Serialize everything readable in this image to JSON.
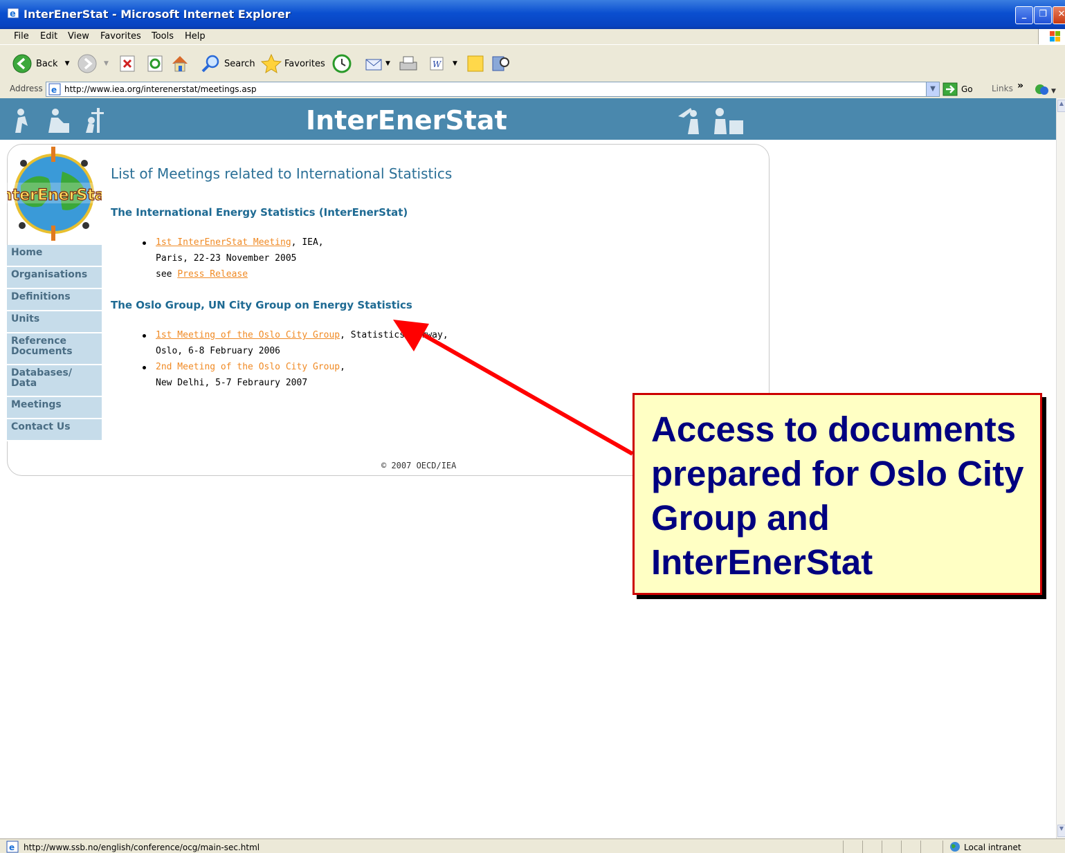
{
  "window": {
    "title": "InterEnerStat - Microsoft Internet Explorer",
    "controls": [
      "minimize",
      "restore",
      "close"
    ]
  },
  "menu": [
    "File",
    "Edit",
    "View",
    "Favorites",
    "Tools",
    "Help"
  ],
  "toolbar": {
    "back_label": "Back",
    "search_label": "Search",
    "favorites_label": "Favorites"
  },
  "address": {
    "label": "Address",
    "url": "http://www.iea.org/interenerstat/meetings.asp",
    "go_label": "Go",
    "links_label": "Links"
  },
  "site": {
    "brand": "InterEnerStat",
    "logo_text": "InterEnerStat",
    "nav": [
      "Home",
      "Organisations",
      "Definitions",
      "Units",
      "Reference Documents",
      "Databases/ Data",
      "Meetings",
      "Contact Us"
    ]
  },
  "page": {
    "heading": "List of Meetings related to International Statistics",
    "section1": {
      "title": "The International Energy Statistics (InterEnerStat)",
      "item_link": "1st InterEnerStat Meeting",
      "item_rest": ", IEA,",
      "line2": "Paris, 22-23 November 2005",
      "line3_prefix": "see ",
      "line3_link": "Press Release"
    },
    "section2": {
      "title": "The Oslo Group, UN City Group on Energy Statistics",
      "item1_link": "1st Meeting of the Oslo City Group",
      "item1_rest": ", Statistics Norway,",
      "item1_line2": "Oslo, 6-8 February 2006",
      "item2_text": "2nd Meeting of the Oslo City Group",
      "item2_rest": ",",
      "item2_line2": "New Delhi, 5-7 Febraury 2007"
    },
    "footer": "© 2007 OECD/IEA"
  },
  "status": {
    "url": "http://www.ssb.no/english/conference/ocg/main-sec.html",
    "zone": "Local intranet"
  },
  "callout": {
    "text": "Access to documents prepared for Oslo City Group and InterEnerStat"
  },
  "colors": {
    "title_blue": "#0a4fd0",
    "banner": "#4a88ad",
    "nav_bg": "#c6dcea",
    "link_orange": "#f08a24",
    "heading_teal": "#2a6f96",
    "callout_bg": "#ffffc4",
    "callout_border": "#cc0000",
    "callout_text": "#000080",
    "arrow": "#ff0000"
  }
}
